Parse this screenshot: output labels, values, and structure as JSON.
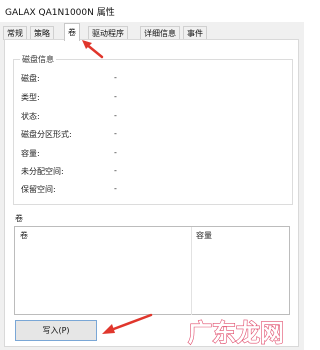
{
  "window": {
    "title": "GALAX QA1N1000N 属性"
  },
  "tabs": [
    {
      "label": "常规"
    },
    {
      "label": "策略"
    },
    {
      "label": "卷"
    },
    {
      "label": "驱动程序"
    },
    {
      "label": "详细信息"
    },
    {
      "label": "事件"
    }
  ],
  "active_tab": "卷",
  "disk_info": {
    "group_title": "磁盘信息",
    "rows": [
      {
        "label": "磁盘:",
        "value": "-"
      },
      {
        "label": "类型:",
        "value": "-"
      },
      {
        "label": "状态:",
        "value": "-"
      },
      {
        "label": "磁盘分区形式:",
        "value": "-"
      },
      {
        "label": "容量:",
        "value": "-"
      },
      {
        "label": "未分配空间:",
        "value": "-"
      },
      {
        "label": "保留空间:",
        "value": "-"
      }
    ]
  },
  "volumes": {
    "label": "卷",
    "columns": [
      "卷",
      "容量"
    ],
    "rows": []
  },
  "buttons": {
    "write": "写入(P)"
  },
  "watermark": {
    "text": "广东龙网",
    "color": "#e04a6a"
  },
  "annotation_color": "#e0362c"
}
